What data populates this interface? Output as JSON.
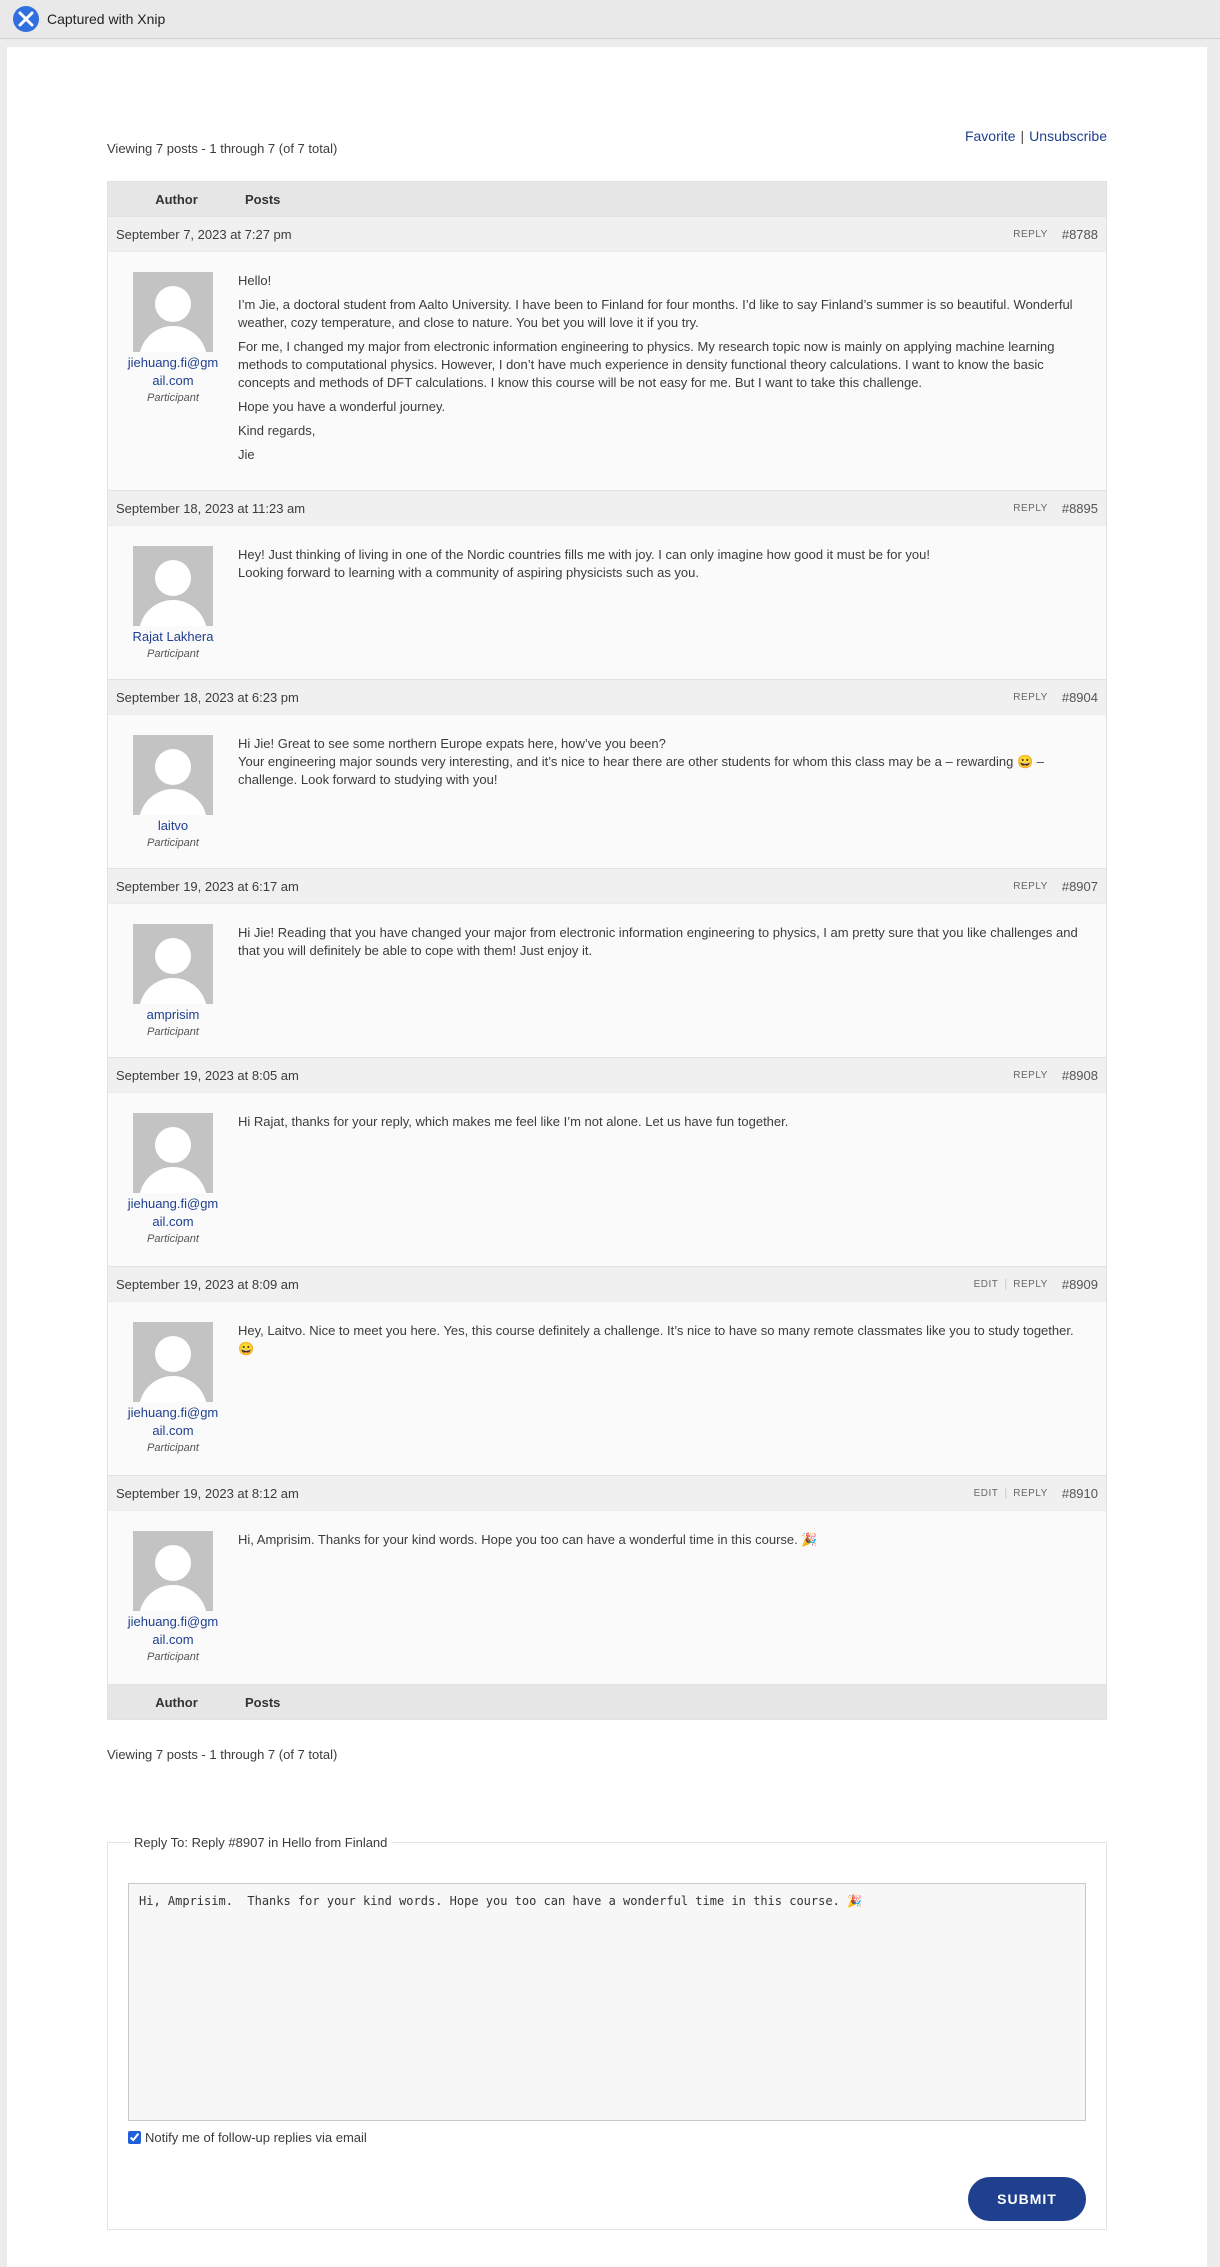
{
  "app": {
    "title": "Captured with Xnip"
  },
  "topnav": {
    "favorite": "Favorite",
    "separator": "|",
    "unsubscribe": "Unsubscribe"
  },
  "viewing": "Viewing 7 posts - 1 through 7 (of 7 total)",
  "table": {
    "author_header": "Author",
    "posts_header": "Posts"
  },
  "labels": {
    "reply": "REPLY",
    "edit": "EDIT"
  },
  "posts": [
    {
      "date": "September 7, 2023 at 7:27 pm",
      "id": "#8788",
      "author": "jiehuang.fi@gmail.com",
      "role": "Participant",
      "paragraphs": [
        "Hello!",
        "I’m Jie, a doctoral student from Aalto University. I have been to Finland for four months. I’d like to say Finland’s summer is so beautiful. Wonderful weather, cozy temperature, and close to nature. You bet you will love it if you try.",
        "For me, I changed my major from electronic information engineering to physics. My research topic now is mainly on applying machine learning methods to computational physics. However, I don’t have much experience in density functional theory calculations. I want to know the basic concepts and methods of DFT calculations. I know this course will be not easy for me. But I want to take this challenge.",
        "Hope you have a wonderful journey.",
        "Kind regards,",
        "Jie"
      ]
    },
    {
      "date": "September 18, 2023 at 11:23 am",
      "id": "#8895",
      "author": "Rajat Lakhera",
      "role": "Participant",
      "paragraphs": [
        "Hey! Just thinking of living in one of the Nordic countries fills me with joy. I can only imagine how good it must be for you!\nLooking forward to learning with a community of aspiring physicists such as you."
      ]
    },
    {
      "date": "September 18, 2023 at 6:23 pm",
      "id": "#8904",
      "author": "laitvo",
      "role": "Participant",
      "paragraphs": [
        "Hi Jie! Great to see some northern Europe expats here, how’ve you been?\nYour engineering major sounds very interesting, and it’s nice to hear there are other students for whom this class may be a – rewarding 😀 – challenge. Look forward to studying with you!"
      ]
    },
    {
      "date": "September 19, 2023 at 6:17 am",
      "id": "#8907",
      "author": "amprisim",
      "role": "Participant",
      "paragraphs": [
        "Hi Jie! Reading that you have changed your major from electronic information engineering to physics, I am pretty sure that you like challenges and that you will definitely be able to cope with them! Just enjoy it."
      ]
    },
    {
      "date": "September 19, 2023 at 8:05 am",
      "id": "#8908",
      "author": "jiehuang.fi@gmail.com",
      "role": "Participant",
      "paragraphs": [
        "Hi Rajat, thanks for your reply, which makes me feel like I’m not alone. Let us have fun together."
      ]
    },
    {
      "date": "September 19, 2023 at 8:09 am",
      "id": "#8909",
      "editable": true,
      "author": "jiehuang.fi@gmail.com",
      "role": "Participant",
      "paragraphs": [
        "Hey, Laitvo. Nice to meet you here. Yes, this course definitely a challenge. It’s nice to have so many remote classmates like you to study together. 😀"
      ]
    },
    {
      "date": "September 19, 2023 at 8:12 am",
      "id": "#8910",
      "editable": true,
      "author": "jiehuang.fi@gmail.com",
      "role": "Participant",
      "paragraphs": [
        "Hi, Amprisim. Thanks for your kind words. Hope you too can have a wonderful time in this course. 🎉"
      ]
    }
  ],
  "reply_form": {
    "legend": "Reply To: Reply #8907 in Hello from Finland",
    "textarea_value": "Hi, Amprisim.  Thanks for your kind words. Hope you too can have a wonderful time in this course. 🎉",
    "notify_label": "Notify me of follow-up replies via email",
    "notify_checked": true,
    "submit_label": "SUBMIT"
  },
  "colors": {
    "link": "#1f3f8f",
    "submit_bg": "#1f3f8f",
    "header_bg": "#e6e6e6",
    "post_head_bg": "#f0f0f0"
  }
}
